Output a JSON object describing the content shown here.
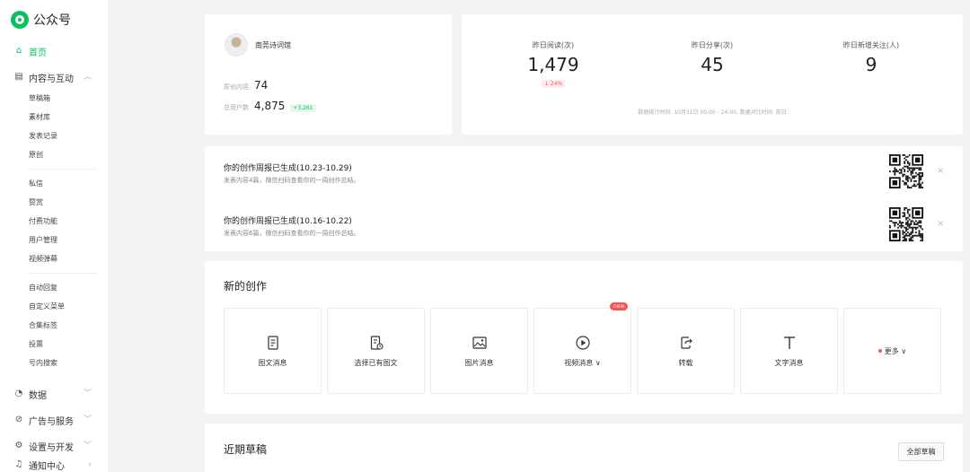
{
  "sidebar": {
    "app_name": "公众号",
    "home": "首页",
    "content_group": "内容与互动",
    "content_items": [
      "草稿箱",
      "素材库",
      "发表记录",
      "原创"
    ],
    "interact_items": [
      "私信",
      "赞赏",
      "付费功能",
      "用户管理",
      "视频弹幕"
    ],
    "auto_items": [
      "自动回复",
      "自定义菜单",
      "合集标签",
      "投票",
      "号内搜索"
    ],
    "data_group": "数据",
    "ads_group": "广告与服务",
    "settings_group": "设置与开发",
    "notify_group": "通知中心"
  },
  "profile": {
    "account_name": "南莞诗词馆",
    "original_label": "原创内容",
    "original_value": "74",
    "users_label": "总用户数",
    "users_value": "4,875",
    "users_delta": "+3,261"
  },
  "metrics": {
    "items": [
      {
        "label": "昨日阅读(次)",
        "value": "1,479",
        "delta": "↓ 24%"
      },
      {
        "label": "昨日分享(次)",
        "value": "45"
      },
      {
        "label": "昨日新增关注(人)",
        "value": "9"
      }
    ],
    "note": "数据统计时间: 10月31日 00:00 - 24:00, 数据对比时间: 前日"
  },
  "reports": [
    {
      "title": "你的创作周报已生成(10.23-10.29)",
      "desc": "发表内容4篇，微信扫码查看你的一周创作总结。"
    },
    {
      "title": "你的创作周报已生成(10.16-10.22)",
      "desc": "发表内容6篇，微信扫码查看你的一周创作总结。"
    }
  ],
  "creation": {
    "title": "新的创作",
    "tiles": [
      {
        "label": "图文消息",
        "icon": "article-icon"
      },
      {
        "label": "选择已有图文",
        "icon": "existing-article-icon"
      },
      {
        "label": "图片消息",
        "icon": "image-icon"
      },
      {
        "label": "视频消息 ∨",
        "icon": "video-icon",
        "badge": "new"
      },
      {
        "label": "转载",
        "icon": "repost-icon"
      },
      {
        "label": "文字消息",
        "icon": "text-icon"
      }
    ],
    "more_label": "更多 ∨"
  },
  "drafts": {
    "title": "近期草稿",
    "all_button": "全部草稿"
  },
  "colors": {
    "accent": "#07c160",
    "alert": "#fa5151",
    "background": "#f2f3f5"
  }
}
